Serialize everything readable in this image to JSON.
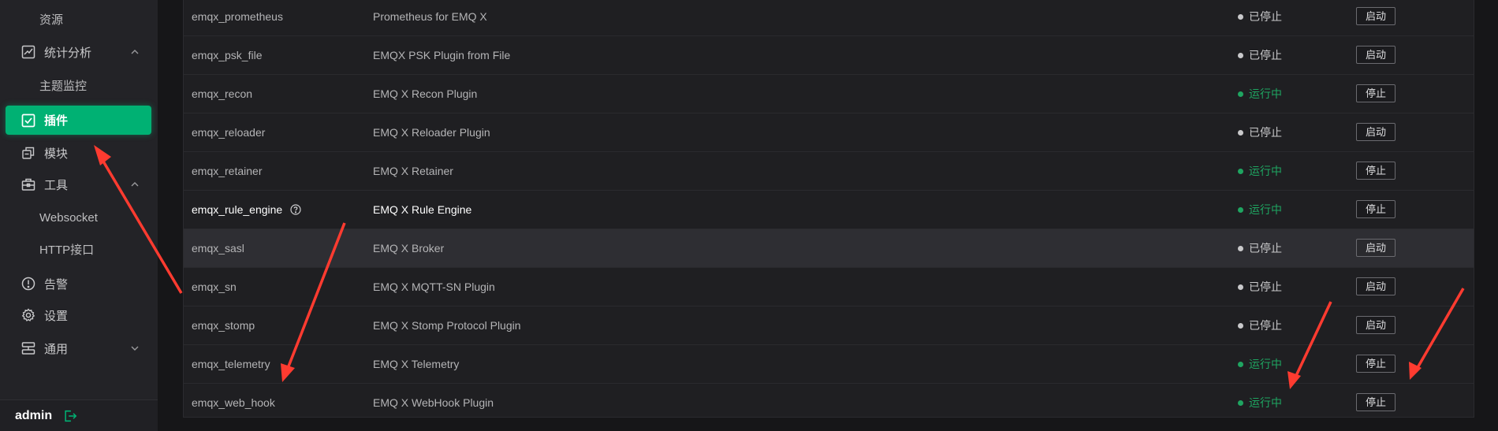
{
  "sidebar": {
    "items": [
      {
        "label": "资源",
        "type": "sub"
      },
      {
        "label": "统计分析",
        "type": "group",
        "icon": "chart-line-icon",
        "expanded": true
      },
      {
        "label": "主题监控",
        "type": "sub"
      },
      {
        "label": "插件",
        "type": "item",
        "icon": "checkbox-icon",
        "active": true
      },
      {
        "label": "模块",
        "type": "item",
        "icon": "modules-icon"
      },
      {
        "label": "工具",
        "type": "group",
        "icon": "toolbox-icon",
        "expanded": true
      },
      {
        "label": "Websocket",
        "type": "sub"
      },
      {
        "label": "HTTP接口",
        "type": "sub"
      },
      {
        "label": "告警",
        "type": "item",
        "icon": "alert-icon"
      },
      {
        "label": "设置",
        "type": "item",
        "icon": "gear-icon"
      },
      {
        "label": "通用",
        "type": "group",
        "icon": "general-icon",
        "expanded": false
      }
    ],
    "footer": {
      "username": "admin",
      "logout_icon": "logout-icon"
    }
  },
  "plugins": {
    "rows": [
      {
        "name": "emqx_prometheus",
        "description": "Prometheus for EMQ X",
        "status": "已停止",
        "state": "stopped",
        "action": "启动"
      },
      {
        "name": "emqx_psk_file",
        "description": "EMQX PSK Plugin from File",
        "status": "已停止",
        "state": "stopped",
        "action": "启动"
      },
      {
        "name": "emqx_recon",
        "description": "EMQ X Recon Plugin",
        "status": "运行中",
        "state": "running",
        "action": "停止"
      },
      {
        "name": "emqx_reloader",
        "description": "EMQ X Reloader Plugin",
        "status": "已停止",
        "state": "stopped",
        "action": "启动"
      },
      {
        "name": "emqx_retainer",
        "description": "EMQ X Retainer",
        "status": "运行中",
        "state": "running",
        "action": "停止"
      },
      {
        "name": "emqx_rule_engine",
        "description": "EMQ X Rule Engine",
        "status": "运行中",
        "state": "running",
        "action": "停止",
        "help_icon": "question-circle-icon"
      },
      {
        "name": "emqx_sasl",
        "description": "EMQ X Broker",
        "status": "已停止",
        "state": "stopped",
        "action": "启动"
      },
      {
        "name": "emqx_sn",
        "description": "EMQ X MQTT-SN Plugin",
        "status": "已停止",
        "state": "stopped",
        "action": "启动"
      },
      {
        "name": "emqx_stomp",
        "description": "EMQ X Stomp Protocol Plugin",
        "status": "已停止",
        "state": "stopped",
        "action": "启动"
      },
      {
        "name": "emqx_telemetry",
        "description": "EMQ X Telemetry",
        "status": "运行中",
        "state": "running",
        "action": "停止"
      },
      {
        "name": "emqx_web_hook",
        "description": "EMQ X WebHook Plugin",
        "status": "运行中",
        "state": "running",
        "action": "停止"
      }
    ]
  },
  "colors": {
    "accent": "#00b173",
    "running": "#1fa561",
    "stopped": "#c9c9cb",
    "annotation_arrow": "#ff3b30"
  }
}
